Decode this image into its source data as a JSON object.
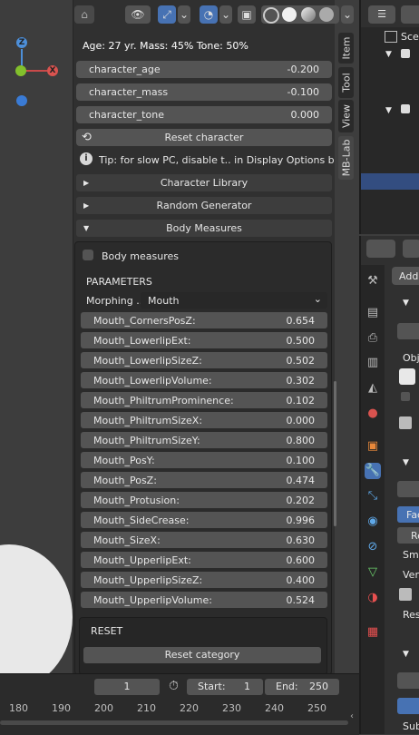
{
  "viewport": {
    "gizmo": {
      "z": "Z",
      "x": "X"
    }
  },
  "panel": {
    "stats": "Age: 27 yr.  Mass: 45%  Tone: 50%",
    "properties": [
      {
        "label": "character_age",
        "value": "-0.200"
      },
      {
        "label": "character_mass",
        "value": "-0.100"
      },
      {
        "label": "character_tone",
        "value": "0.000"
      }
    ],
    "reset_character": "Reset character",
    "tip": "Tip: for slow PC, disable t.. in Display Options below",
    "sections": {
      "library": "Character Library",
      "random": "Random Generator",
      "measures": "Body Measures"
    },
    "body_measures_checkbox": "Body measures",
    "parameters_heading": "PARAMETERS",
    "morphing_label": "Morphing ..",
    "morphing_value": "Mouth",
    "morphs": [
      {
        "label": "Mouth_CornersPosZ:",
        "value": "0.654"
      },
      {
        "label": "Mouth_LowerlipExt:",
        "value": "0.500"
      },
      {
        "label": "Mouth_LowerlipSizeZ:",
        "value": "0.502"
      },
      {
        "label": "Mouth_LowerlipVolume:",
        "value": "0.302"
      },
      {
        "label": "Mouth_PhiltrumProminence:",
        "value": "0.102"
      },
      {
        "label": "Mouth_PhiltrumSizeX:",
        "value": "0.000"
      },
      {
        "label": "Mouth_PhiltrumSizeY:",
        "value": "0.800"
      },
      {
        "label": "Mouth_PosY:",
        "value": "0.100"
      },
      {
        "label": "Mouth_PosZ:",
        "value": "0.474"
      },
      {
        "label": "Mouth_Protusion:",
        "value": "0.202"
      },
      {
        "label": "Mouth_SideCrease:",
        "value": "0.996"
      },
      {
        "label": "Mouth_SizeX:",
        "value": "0.630"
      },
      {
        "label": "Mouth_UpperlipExt:",
        "value": "0.600"
      },
      {
        "label": "Mouth_UpperlipSizeZ:",
        "value": "0.400"
      },
      {
        "label": "Mouth_UpperlipVolume:",
        "value": "0.524"
      }
    ],
    "reset_heading": "RESET",
    "reset_category": "Reset category"
  },
  "side_tabs": [
    "Item",
    "Tool",
    "View",
    "MB-Lab"
  ],
  "outliner": {
    "scene_label": "Scen"
  },
  "properties_editor": {
    "add_label": "Add",
    "labels": [
      "Obj",
      "Fac",
      "Re",
      "Sm",
      "Ver",
      "Res",
      "Sub"
    ]
  },
  "timeline": {
    "current_frame": "1",
    "start_label": "Start:",
    "start_value": "1",
    "end_label": "End:",
    "end_value": "250",
    "ticks": [
      "180",
      "190",
      "200",
      "210",
      "220",
      "230",
      "240",
      "250"
    ]
  },
  "colors": {
    "accent": "#4772b3",
    "panel": "#303030",
    "field": "#545454"
  }
}
